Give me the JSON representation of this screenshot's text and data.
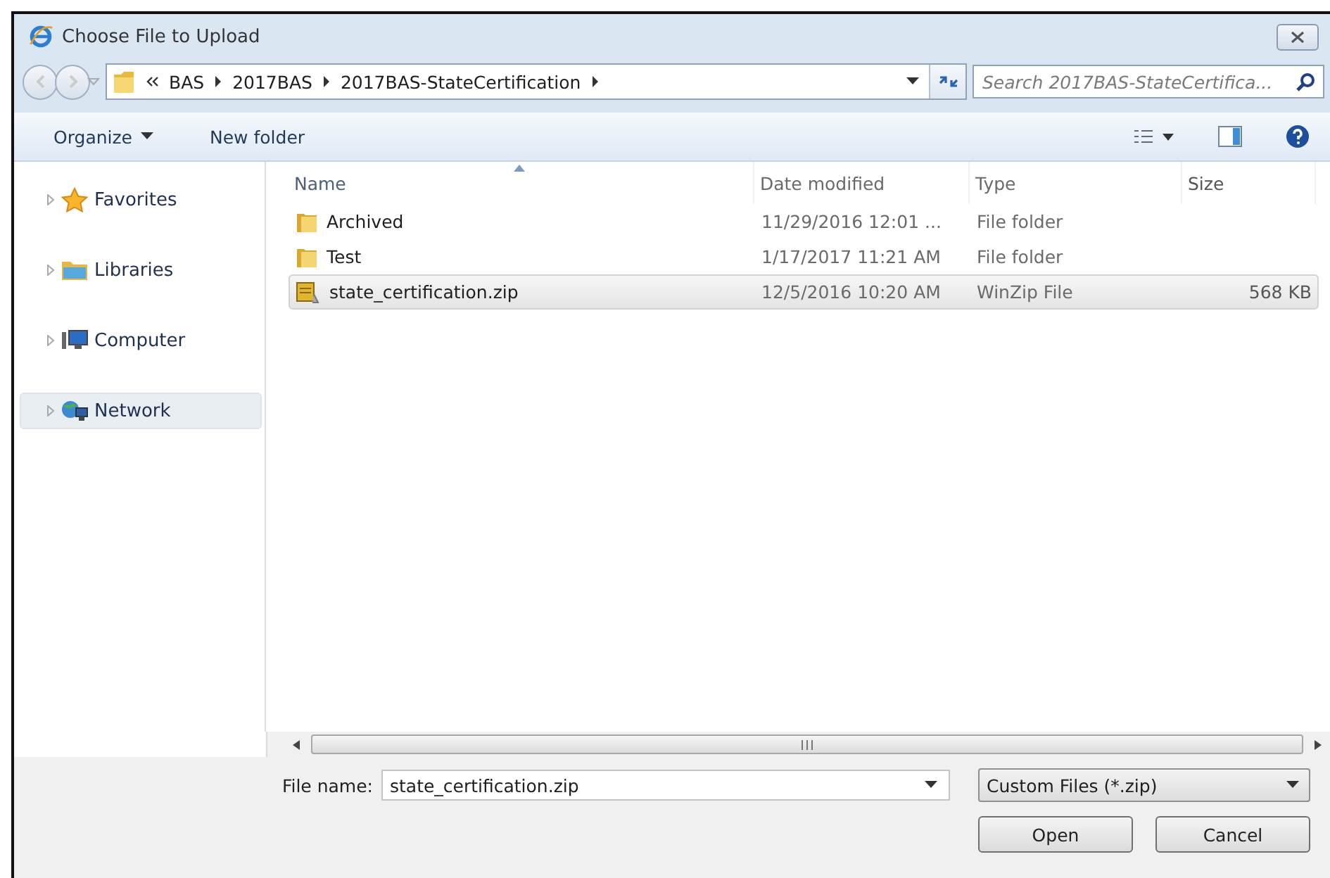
{
  "window": {
    "title": "Choose File to Upload"
  },
  "address": {
    "crumbs": [
      "BAS",
      "2017BAS",
      "2017BAS-StateCertification"
    ]
  },
  "search": {
    "placeholder": "Search 2017BAS-StateCertifica..."
  },
  "toolbar": [
    {
      "label": "Organize",
      "kind": "menu"
    },
    {
      "label": "New folder",
      "kind": "button"
    }
  ],
  "sidebar": {
    "items": [
      {
        "label": "Favorites",
        "kind": "favorites",
        "selected": false
      },
      {
        "label": "Libraries",
        "kind": "libraries",
        "selected": false
      },
      {
        "label": "Computer",
        "kind": "computer",
        "selected": false
      },
      {
        "label": "Network",
        "kind": "network",
        "selected": true
      }
    ]
  },
  "table": {
    "columns": [
      "Name",
      "Date modified",
      "Type",
      "Size"
    ],
    "rows": [
      {
        "kind": "folder",
        "name": "Archived",
        "date": "11/29/2016 12:01 ...",
        "type": "File folder",
        "size": "",
        "selected": false
      },
      {
        "kind": "folder",
        "name": "Test",
        "date": "1/17/2017 11:21 AM",
        "type": "File folder",
        "size": "",
        "selected": false
      },
      {
        "kind": "zip",
        "name": "state_certification.zip",
        "date": "12/5/2016 10:20 AM",
        "type": "WinZip File",
        "size": "568 KB",
        "selected": true
      }
    ]
  },
  "file_name": {
    "label": "File name:",
    "value": "state_certification.zip"
  },
  "filter": {
    "value": "Custom Files (*.zip)"
  },
  "buttons": [
    "Open",
    "Cancel"
  ]
}
